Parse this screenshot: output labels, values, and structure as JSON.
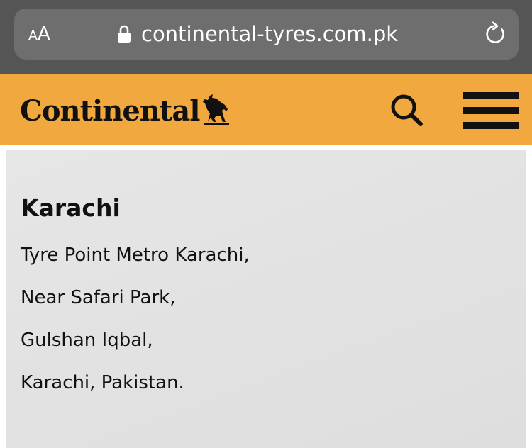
{
  "browser": {
    "text_size_small": "A",
    "text_size_large": "A",
    "url": "continental-tyres.com.pk",
    "icons": [
      "lock-icon",
      "reload-icon"
    ],
    "colors": {
      "chrome": "#555555",
      "url_bar": "#6e6e6e"
    }
  },
  "header": {
    "logo_text": "Continental",
    "icons": [
      "horse-icon",
      "search-icon",
      "hamburger-menu-icon"
    ],
    "colors": {
      "background": "#f1a83e",
      "foreground": "#111111"
    }
  },
  "location": {
    "city": "Karachi",
    "address_lines": [
      "Tyre Point Metro Karachi,",
      "Near Safari Park,",
      "Gulshan Iqbal,",
      "Karachi, Pakistan."
    ],
    "colors": {
      "card_background": "#e3e3e3"
    }
  }
}
